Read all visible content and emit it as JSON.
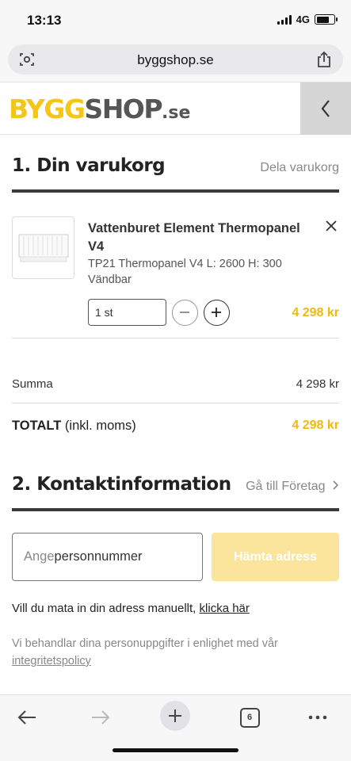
{
  "status": {
    "time": "13:13",
    "network": "4G"
  },
  "browser": {
    "url": "byggshop.se",
    "tab_count": "6"
  },
  "site": {
    "logo_part1": "BYGG",
    "logo_part2": "SHOP",
    "logo_part3": ".se",
    "back_icon": "chevron-left-icon"
  },
  "cart": {
    "title": "1. Din varukorg",
    "share_label": "Dela varukorg",
    "item": {
      "name": "Vattenburet Element Thermopanel V4",
      "desc": "TP21 Thermopanel V4 L: 2600 H: 300",
      "variant": "Vändbar",
      "qty": "1 st",
      "price": "4 298 kr"
    },
    "summa_label": "Summa",
    "summa_value": "4 298 kr",
    "total_label": "TOTALT",
    "total_note": "(inkl. moms)",
    "total_value": "4 298 kr"
  },
  "contact": {
    "title": "2. Kontaktinformation",
    "company_link": "Gå till Företag",
    "pn_placeholder": "Ange",
    "pn_value": "personnummer",
    "fetch_label": "Hämta adress",
    "manual_text": "Vill du mata in din adress manuellt,",
    "manual_link": "klicka här",
    "privacy_text": "Vi behandlar dina personuppgifter i enlighet med vår",
    "privacy_link": "integritetspolicy"
  },
  "colors": {
    "accent": "#f0b90b",
    "button_disabled": "#fbe49c"
  }
}
